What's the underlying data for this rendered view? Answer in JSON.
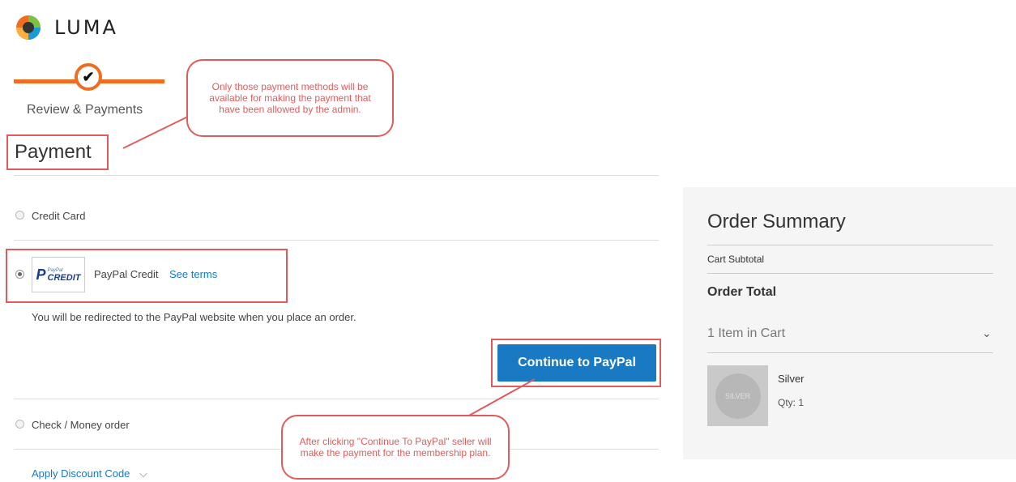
{
  "brand": {
    "name": "LUMA"
  },
  "progress": {
    "step_label": "Review & Payments",
    "check_glyph": "✔"
  },
  "payment": {
    "title": "Payment",
    "methods": [
      {
        "label": "Credit Card"
      },
      {
        "label": "PayPal Credit",
        "link": "See terms",
        "logo_small": "PayPal",
        "logo_credit": "CREDIT",
        "logo_p": "P"
      },
      {
        "label": "Check / Money order"
      }
    ],
    "redirect_note": "You will be redirected to the PayPal website when you place an order.",
    "continue_label": "Continue to PayPal",
    "discount_label": "Apply Discount Code",
    "discount_chevron": "⌵"
  },
  "callouts": {
    "top": "Only those payment methods will be available for making the payment that have been allowed by the admin.",
    "bottom": "After clicking \"Continue To PayPal\" seller will make the payment for the membership plan."
  },
  "summary": {
    "title": "Order Summary",
    "cart_subtotal": "Cart Subtotal",
    "order_total": "Order Total",
    "items_in_cart": "1 Item in Cart",
    "chevron": "⌄",
    "item": {
      "name": "Silver",
      "qty_label": "Qty:",
      "qty": "1",
      "thumb_text": "SILVER"
    }
  },
  "colors": {
    "accent": "#ef6c21",
    "link": "#1979c3",
    "annotation": "#e05c5c"
  }
}
